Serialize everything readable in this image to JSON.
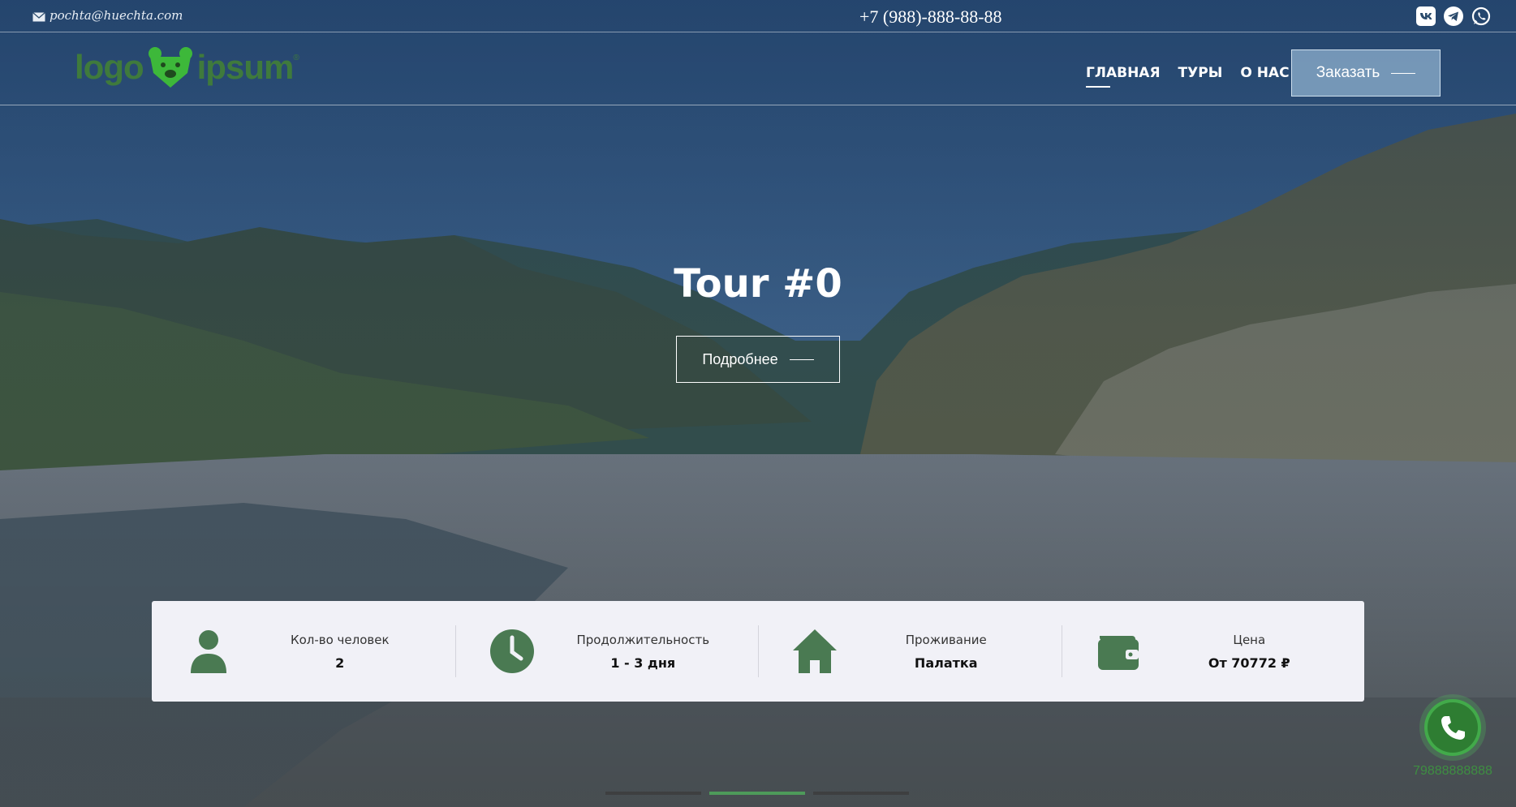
{
  "topbar": {
    "email": "pochta@huechta.com",
    "phone": "+7 (988)-888-88-88",
    "socials": [
      "vk-icon",
      "telegram-icon",
      "whatsapp-icon"
    ]
  },
  "header": {
    "logo_left": "logo",
    "logo_right": "ipsum",
    "logo_mark": "®",
    "nav": [
      {
        "label": "ГЛАВНАЯ",
        "active": true
      },
      {
        "label": "ТУРЫ",
        "active": false
      },
      {
        "label": "О НАС",
        "active": false
      }
    ],
    "order_button": "Заказать"
  },
  "hero": {
    "title": "Tour #0",
    "more_button": "Подробнее"
  },
  "info": [
    {
      "icon": "person-icon",
      "label": "Кол-во человек",
      "value": "2"
    },
    {
      "icon": "clock-icon",
      "label": "Продолжительность",
      "value": "1 - 3 дня"
    },
    {
      "icon": "house-icon",
      "label": "Проживание",
      "value": "Палатка"
    },
    {
      "icon": "wallet-icon",
      "label": "Цена",
      "value": "От 70772 ₽"
    }
  ],
  "call_widget": {
    "number": "79888888888"
  },
  "slider": {
    "count": 3,
    "active": 2
  },
  "colors": {
    "brand_green": "#3f7a3c",
    "icon_green": "#4a7a52",
    "overlay": "#1c3456"
  }
}
